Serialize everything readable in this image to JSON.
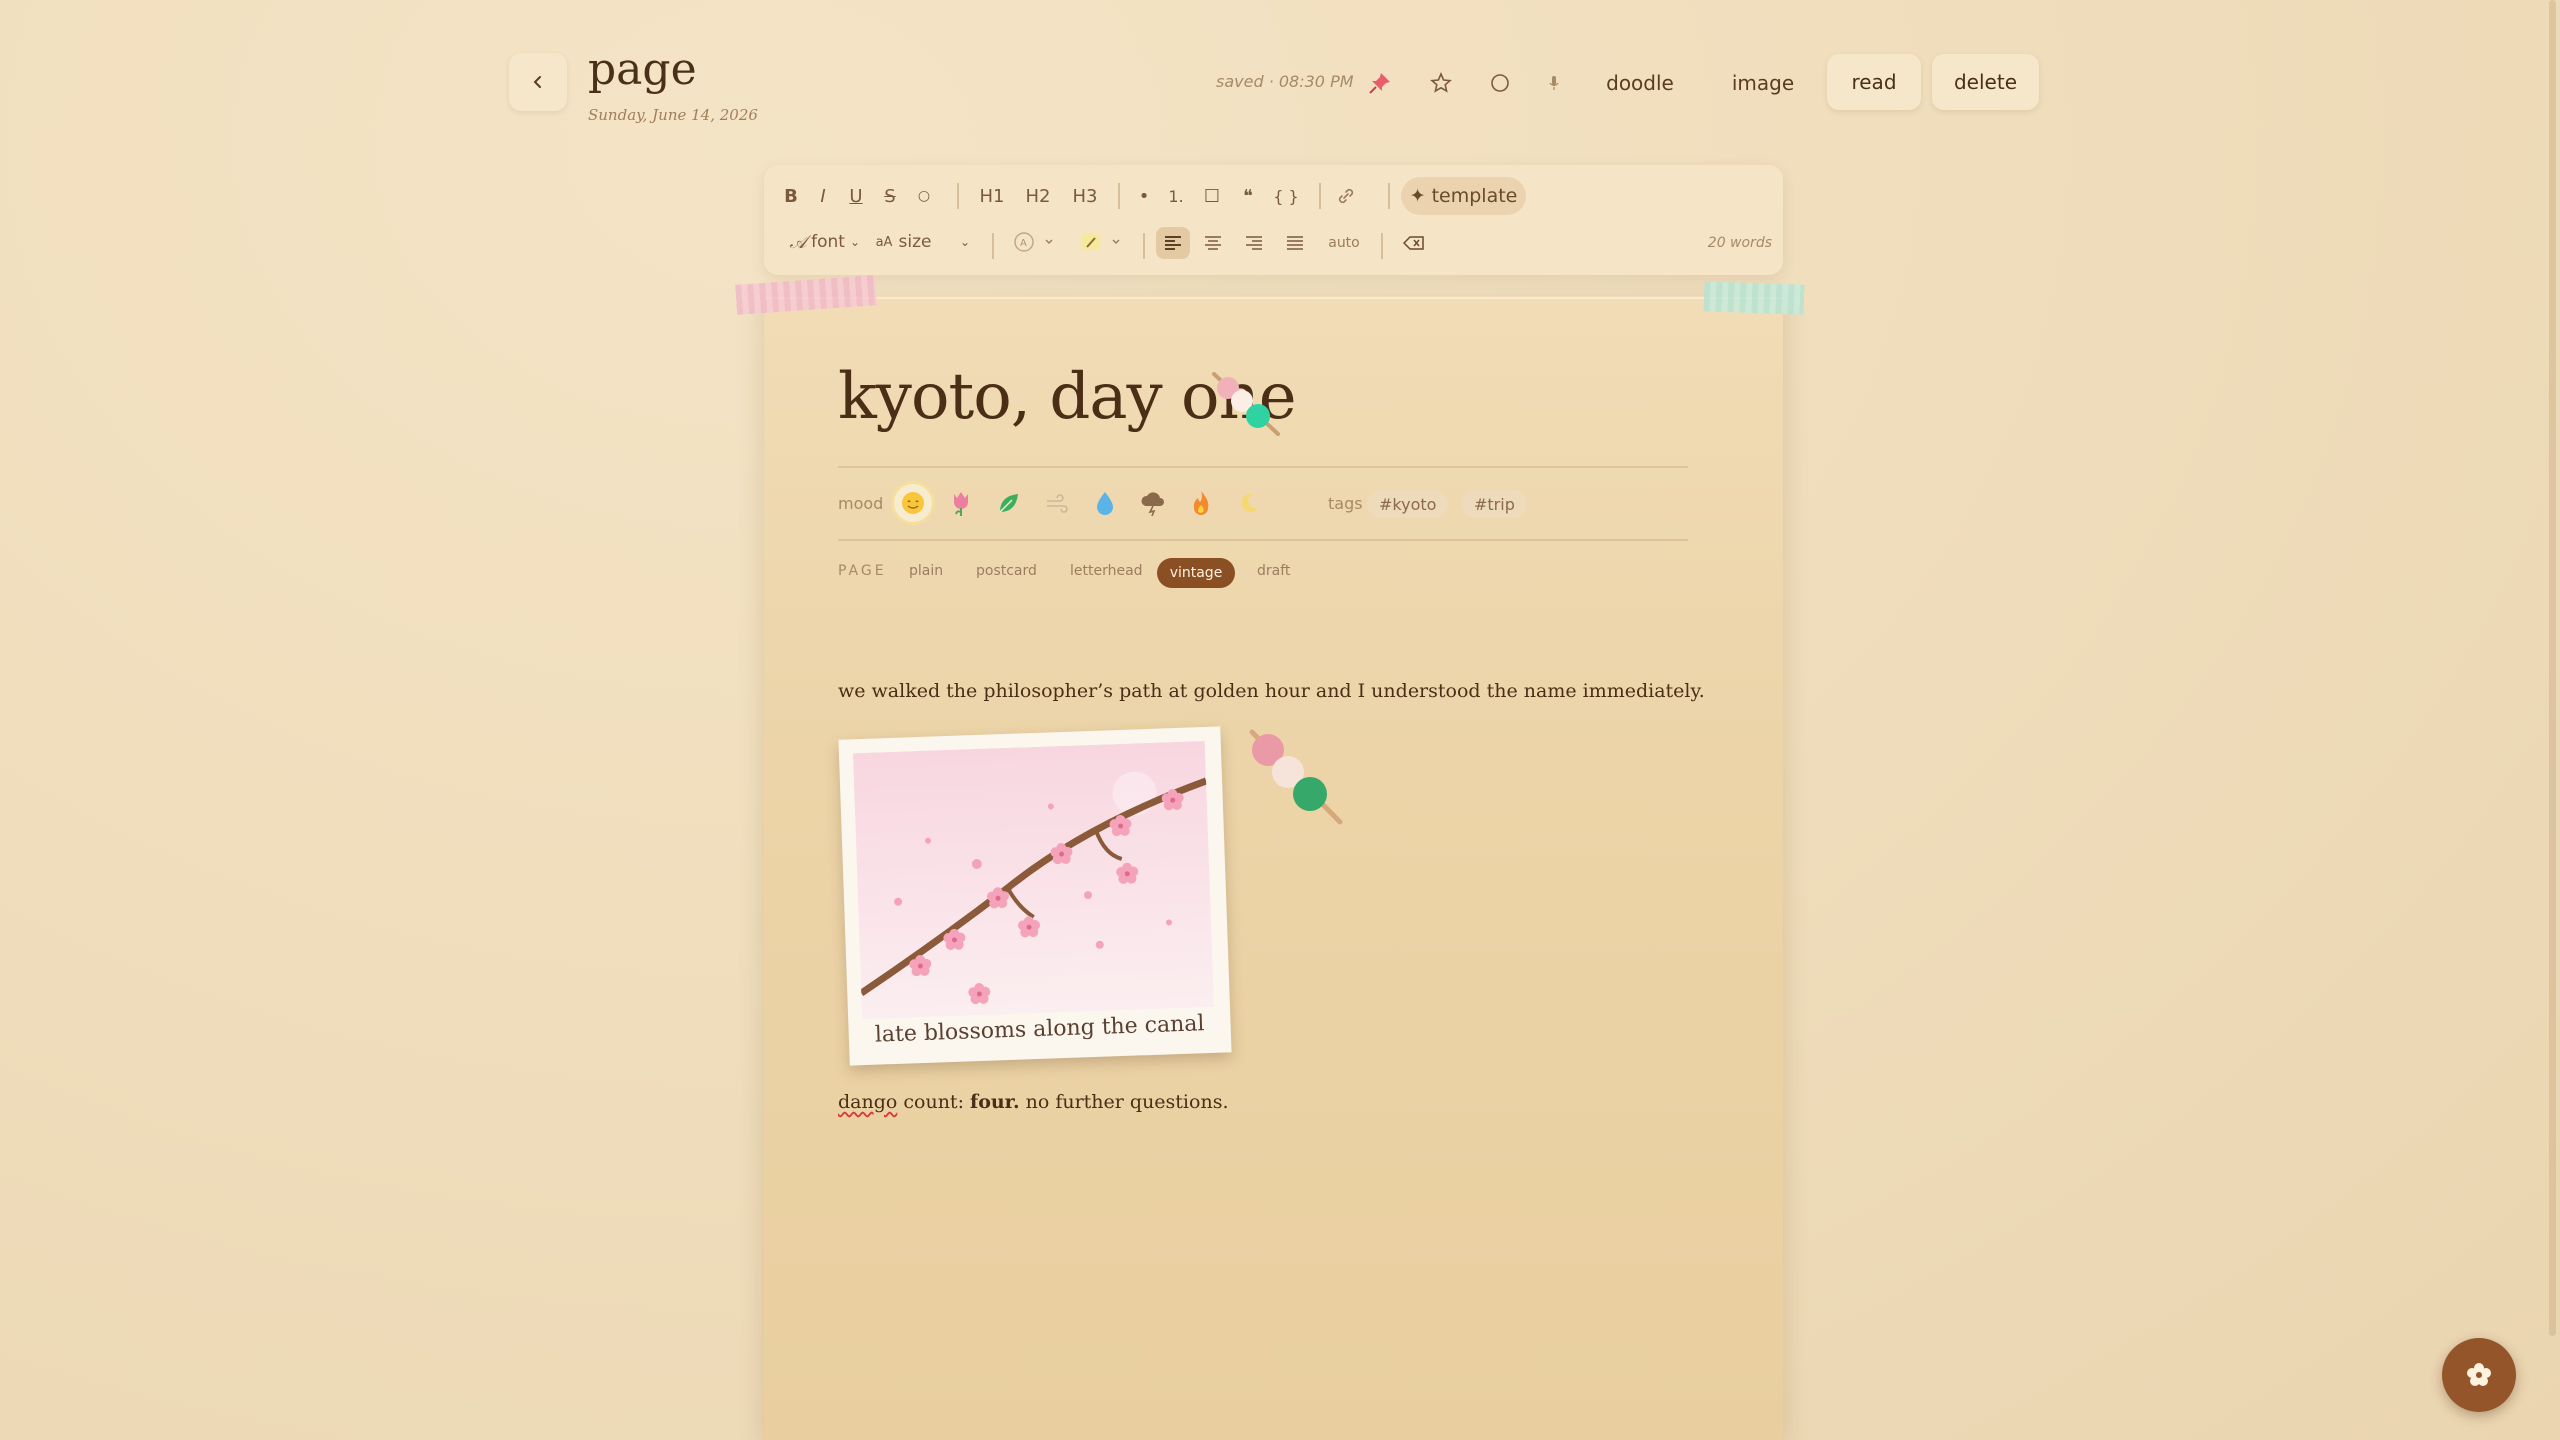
{
  "header": {
    "title": "page",
    "date": "Sunday, June 14, 2026",
    "saved": "saved · 08:30 PM",
    "actions": {
      "doodle": "doodle",
      "image": "image",
      "read": "read",
      "delete": "delete"
    }
  },
  "toolbar": {
    "bold": "B",
    "italic": "I",
    "underline": "U",
    "strike": "S",
    "highlight": "○",
    "h1": "H1",
    "h2": "H2",
    "h3": "H3",
    "bullet": "•",
    "numbered": "1.",
    "checkbox": "☐",
    "quote": "❝",
    "code": "{ }",
    "template": "✦ template",
    "font": "font",
    "size": "size",
    "size_prefix": "aA",
    "spacing": "auto",
    "word_count": "20 words"
  },
  "entry": {
    "title": "kyoto, day one",
    "mood_label": "mood",
    "tags_label": "tags",
    "tags": [
      "#kyoto",
      "#trip"
    ],
    "page_label": "PAGE",
    "page_types": [
      "plain",
      "postcard",
      "letterhead",
      "vintage",
      "draft"
    ],
    "page_type_selected": "vintage",
    "paragraph1": "we walked the philosopher’s path at golden hour and I understood the name immediately.",
    "photo_caption": "late blossoms along the canal",
    "para2_word": "dango",
    "para2_mid": " count: ",
    "para2_bold": "four.",
    "para2_end": " no further questions."
  },
  "colors": {
    "accent": "#8a4f22",
    "paper": "#ecd4a8",
    "background": "#efdcba"
  }
}
